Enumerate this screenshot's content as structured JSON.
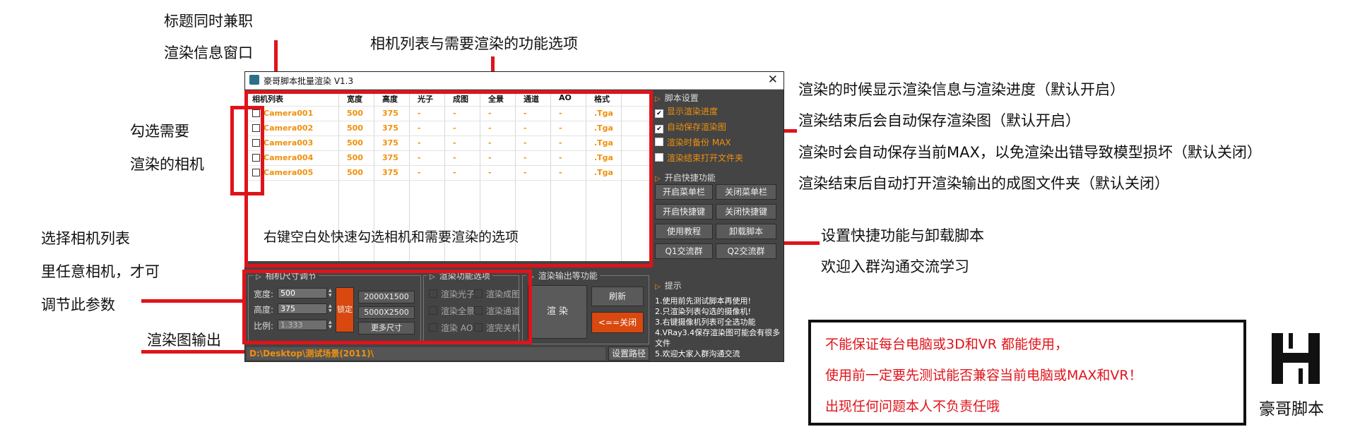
{
  "annotations": {
    "title_window_1": "标题同时兼职",
    "title_window_2": "渲染信息窗口",
    "camera_list_options": "相机列表与需要渲染的功能选项",
    "check_cameras_1": "勾选需要",
    "check_cameras_2": "渲染的相机",
    "select_list_1": "选择相机列表",
    "select_list_2": "里任意相机，才可",
    "select_list_3": "调节此参数",
    "render_output": "渲染图输出",
    "right_1": "渲染的时候显示渲染信息与渲染进度（默认开启）",
    "right_2": "渲染结束后会自动保存渲染图（默认开启）",
    "right_3": "渲染时会自动保存当前MAX，以免渲染出错导致模型损坏（默认关闭）",
    "right_4": "渲染结束后自动打开渲染输出的成图文件夹（默认关闭）",
    "right_5": "设置快捷功能与卸载脚本",
    "right_6": "欢迎入群沟通交流学习"
  },
  "window": {
    "title": "豪哥脚本批量渲染 V1.3",
    "close_glyph": "✕"
  },
  "table": {
    "columns": [
      "相机列表",
      "宽度",
      "高度",
      "光子",
      "成图",
      "全景",
      "通道",
      "AO",
      "格式"
    ],
    "rows": [
      [
        "Camera001",
        "500",
        "375",
        "-",
        "-",
        "-",
        "-",
        "-",
        ".Tga"
      ],
      [
        "Camera002",
        "500",
        "375",
        "-",
        "-",
        "-",
        "-",
        "-",
        ".Tga"
      ],
      [
        "Camera003",
        "500",
        "375",
        "-",
        "-",
        "-",
        "-",
        "-",
        ".Tga"
      ],
      [
        "Camera004",
        "500",
        "375",
        "-",
        "-",
        "-",
        "-",
        "-",
        ".Tga"
      ],
      [
        "Camera005",
        "500",
        "375",
        "-",
        "-",
        "-",
        "-",
        "-",
        ".Tga"
      ]
    ],
    "hint": "右键空白处快速勾选相机和需要渲染的选项"
  },
  "script_settings": {
    "title": "脚本设置",
    "options": [
      {
        "label": "显示渲染进度",
        "checked": true
      },
      {
        "label": "自动保存渲染图",
        "checked": true
      },
      {
        "label": "渲染时备份 MAX",
        "checked": false
      },
      {
        "label": "渲染结束打开文件夹",
        "checked": false
      }
    ]
  },
  "shortcuts": {
    "title": "开启快捷功能",
    "buttons": [
      "开启菜单栏",
      "关闭菜单栏",
      "开启快捷键",
      "关闭快捷键",
      "使用教程",
      "卸载脚本",
      "Q1交流群",
      "Q2交流群"
    ]
  },
  "camera_size": {
    "title": "相机尺寸调节",
    "width_label": "宽度:",
    "width_value": "500",
    "height_label": "高度:",
    "height_value": "375",
    "ratio_label": "比例:",
    "ratio_value": "1.333",
    "lock": "锁定",
    "preset1": "2000X1500",
    "preset2": "5000X2500",
    "more": "更多尺寸"
  },
  "render_options": {
    "title": "渲染功能选项",
    "items": [
      "渲染光子",
      "渲染成图",
      "渲染全景",
      "渲染通道",
      "渲染 AO",
      "渲完关机"
    ]
  },
  "render_output": {
    "title": "渲染输出等功能",
    "render": "渲 染",
    "refresh": "刷新",
    "close": "<==关闭"
  },
  "tips": {
    "title": "提示",
    "lines": [
      "1.使用前先测试脚本再使用!",
      "2.只渲染列表勾选的摄像机!",
      "3.右键摄像机列表可全选功能",
      "4.VRay3.4保存渲染图可能会有很多文件",
      "5.欢迎大家入群沟通交流"
    ]
  },
  "output_path": {
    "value": "D:\\Desktop\\测试场景(2011)\\",
    "button": "设置路径"
  },
  "warning": {
    "line1": "不能保证每台电脑或3D和VR 都能使用，",
    "line2": "使用前一定要先测试能否兼容当前电脑或MAX和VR！",
    "line3": "出现任何问题本人不负责任哦"
  },
  "logo": {
    "text": "豪哥脚本"
  },
  "colors": {
    "accent_orange": "#f0900c",
    "annotation_red": "#e0131a",
    "panel_gray": "#444444",
    "close_button": "#d9480f",
    "lock_button": "#d9480f"
  }
}
